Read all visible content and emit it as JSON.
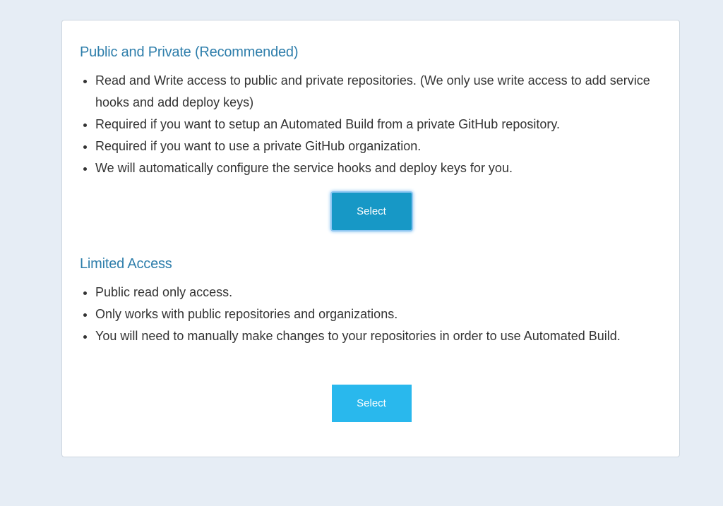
{
  "options": [
    {
      "title": "Public and Private (Recommended)",
      "bullets": [
        "Read and Write access to public and private repositories. (We only use write access to add service hooks and add deploy keys)",
        "Required if you want to setup an Automated Build from a private GitHub repository.",
        "Required if you want to use a private GitHub organization.",
        "We will automatically configure the service hooks and deploy keys for you."
      ],
      "button_label": "Select"
    },
    {
      "title": "Limited Access",
      "bullets": [
        "Public read only access.",
        "Only works with public repositories and organizations.",
        "You will need to manually make changes to your repositories in order to use Automated Build."
      ],
      "button_label": "Select"
    }
  ],
  "colors": {
    "page_background": "#e6edf5",
    "title": "#2e7eab",
    "text": "#333333",
    "button_focused": "#1798c6",
    "button": "#29b8ed"
  }
}
